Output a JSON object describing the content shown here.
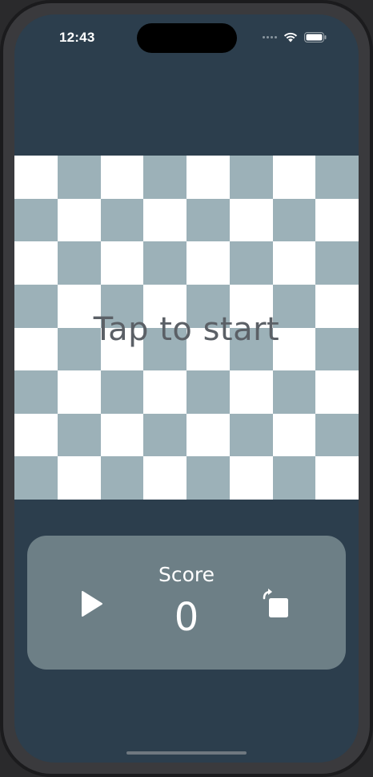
{
  "status_bar": {
    "time": "12:43",
    "icons": [
      "signal-dots-icon",
      "wifi-icon",
      "battery-icon"
    ]
  },
  "board": {
    "columns": 8,
    "rows": 8,
    "pattern": "checkerboard",
    "light_color": "#ffffff",
    "dark_color": "#9cb1b8",
    "overlay_text": "Tap to start"
  },
  "controls": {
    "play_icon": "play-icon",
    "score_label": "Score",
    "score_value": "0",
    "stop_icon": "stop-reset-icon"
  },
  "colors": {
    "background": "#2c3e4d",
    "panel": "#6d7f86",
    "text": "#ffffff",
    "overlay_text": "#5b6066"
  }
}
